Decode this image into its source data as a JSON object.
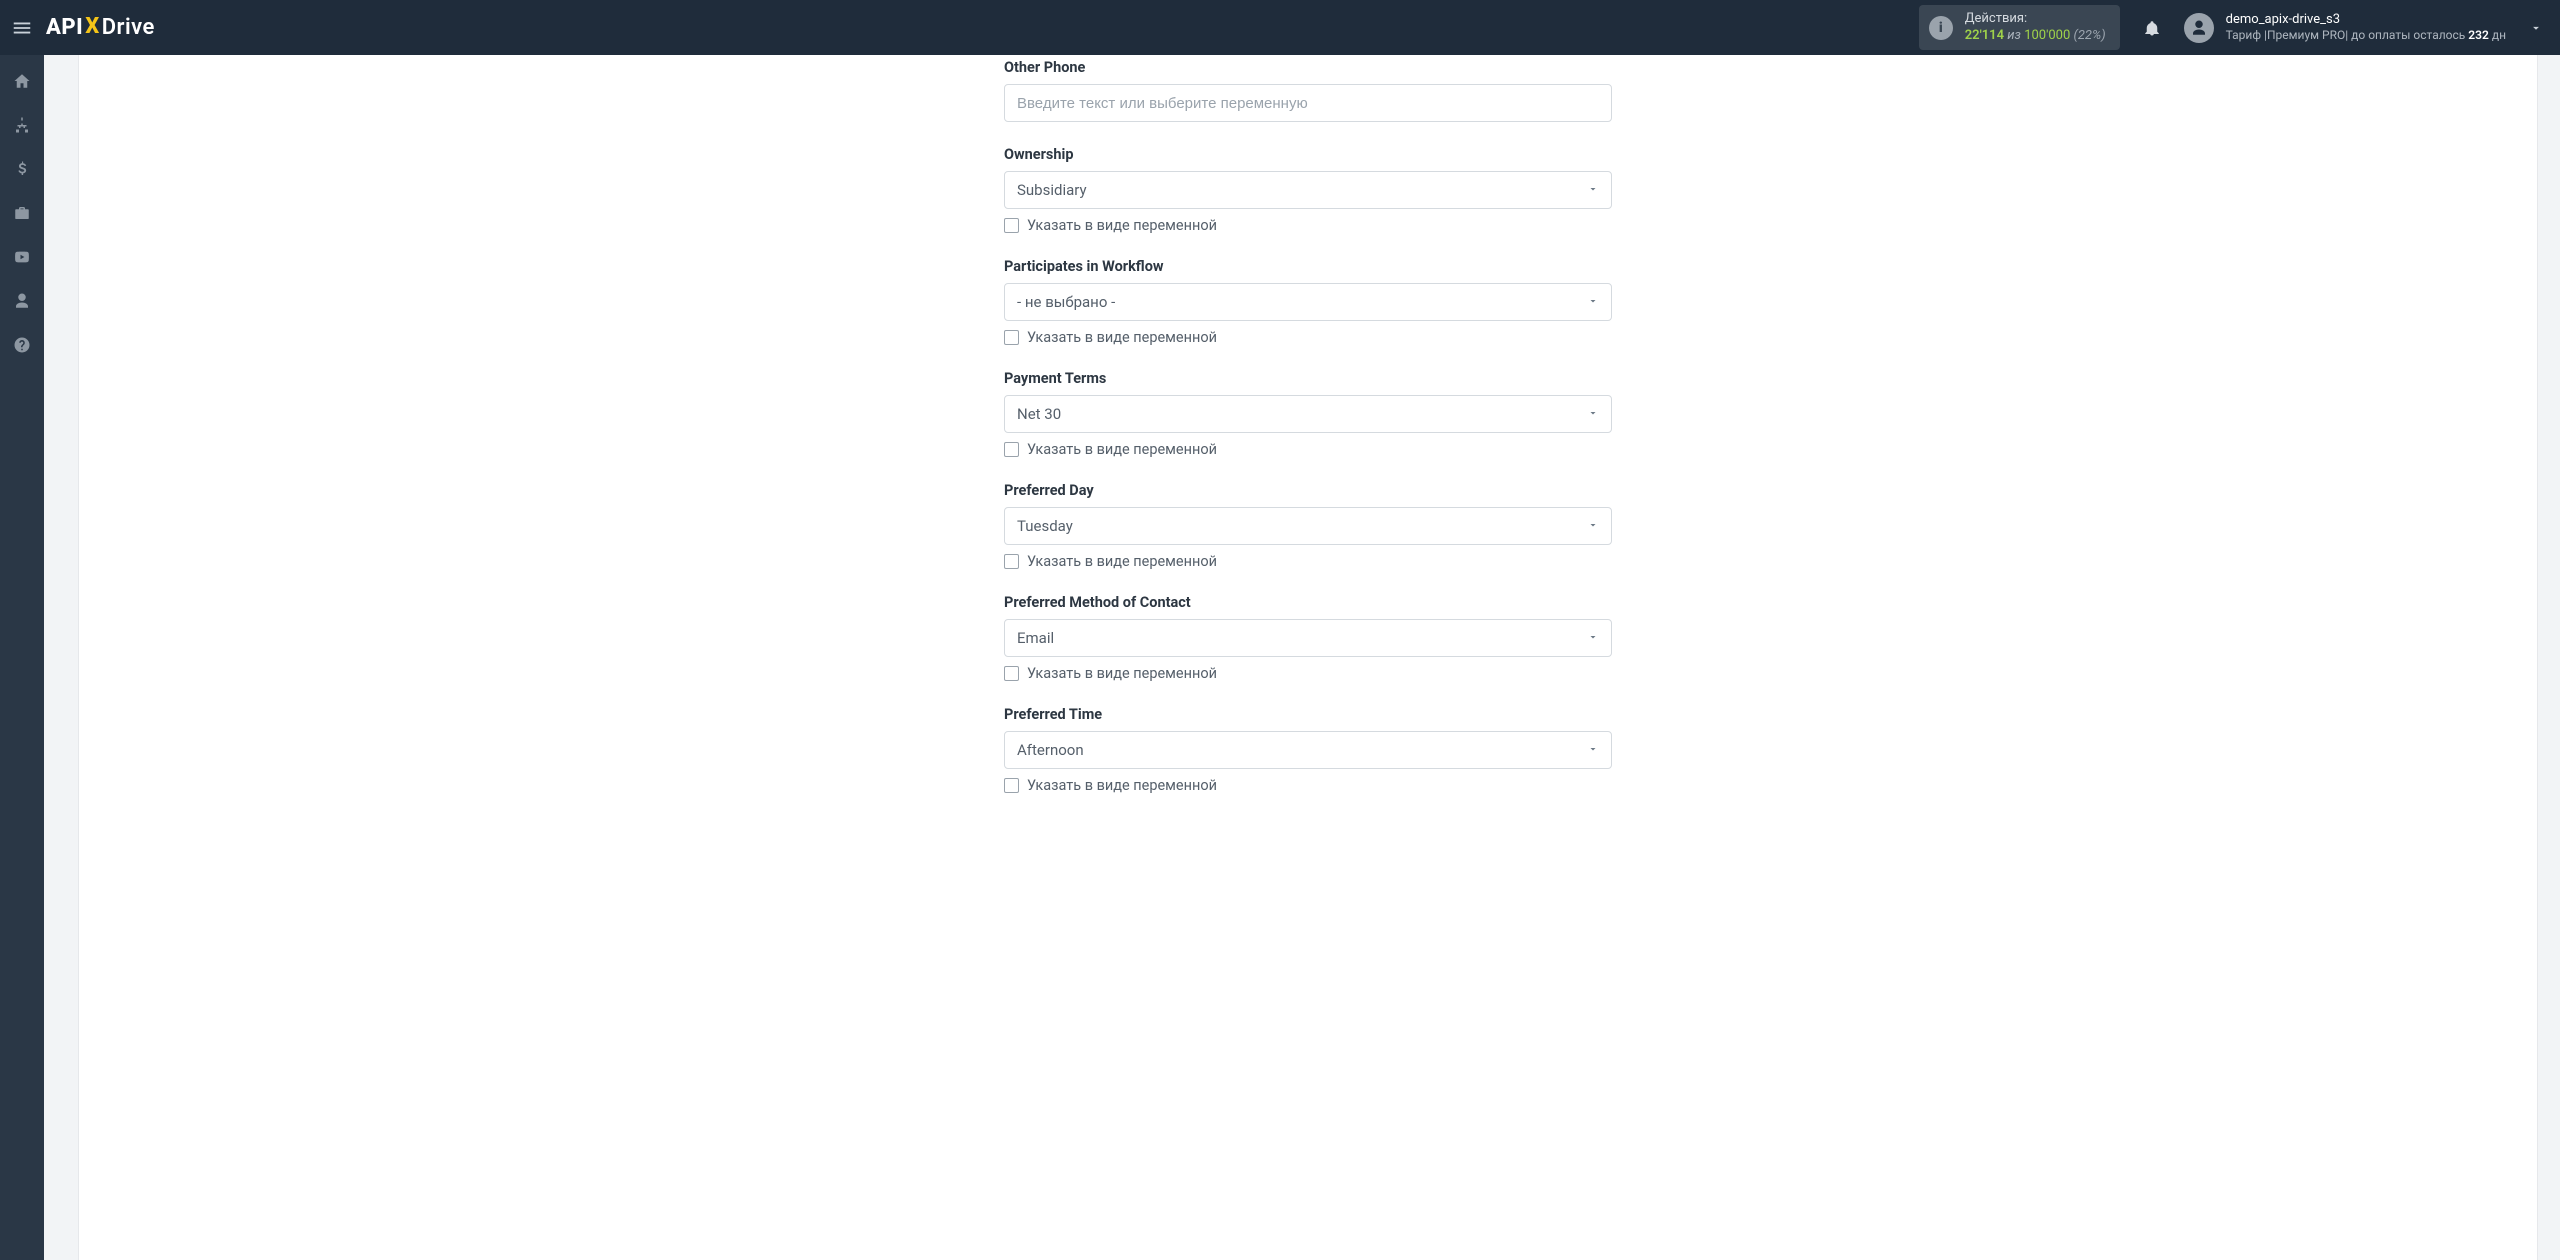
{
  "logo": {
    "api": "API",
    "x": "X",
    "drive": "Drive"
  },
  "topbar": {
    "actions": {
      "label": "Действия:",
      "used": "22'114",
      "of": "из",
      "total": "100'000",
      "pct": "(22%)"
    },
    "user": {
      "name": "demo_apix-drive_s3",
      "tariff_prefix": "Тариф |Премиум PRO| до оплаты осталось ",
      "days": "232",
      "days_suffix": " дн"
    }
  },
  "sidebar": [
    {
      "name": "home-icon"
    },
    {
      "name": "sitemap-icon"
    },
    {
      "name": "dollar-icon"
    },
    {
      "name": "briefcase-icon"
    },
    {
      "name": "youtube-icon"
    },
    {
      "name": "user-icon"
    },
    {
      "name": "help-icon"
    }
  ],
  "form": {
    "var_checkbox_label": "Указать в виде переменной",
    "placeholder_text": "Введите текст или выберите переменную",
    "not_selected": "- не выбрано -",
    "fields": {
      "other_phone": {
        "label": "Other Phone"
      },
      "ownership": {
        "label": "Ownership",
        "value": "Subsidiary"
      },
      "workflow": {
        "label": "Participates in Workflow"
      },
      "payment": {
        "label": "Payment Terms",
        "value": "Net 30"
      },
      "pref_day": {
        "label": "Preferred Day",
        "value": "Tuesday"
      },
      "pref_contact": {
        "label": "Preferred Method of Contact",
        "value": "Email"
      },
      "pref_time": {
        "label": "Preferred Time",
        "value": "Afternoon"
      }
    }
  }
}
